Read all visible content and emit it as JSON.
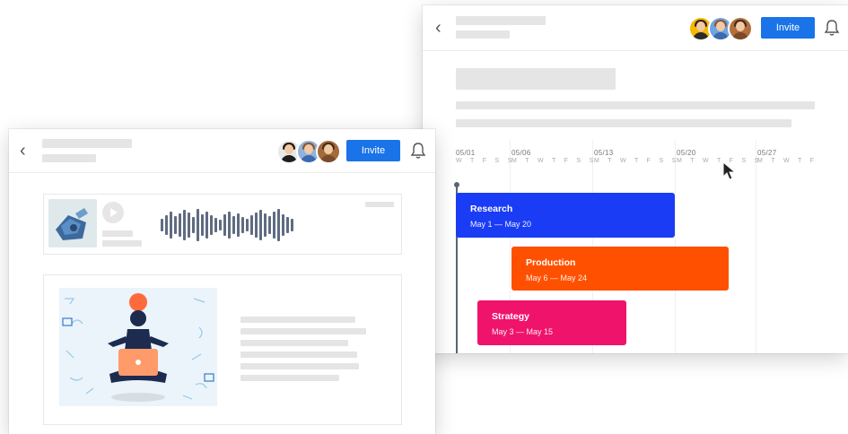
{
  "right_window": {
    "invite_label": "Invite",
    "timeline": {
      "weeks": [
        "05/01",
        "05/06",
        "05/13",
        "05/20",
        "05/27"
      ],
      "weekday_letters": [
        "W T F S S",
        "M T W T F S S",
        "M T W T F S S",
        "M T W T F S S",
        "M T W T F"
      ],
      "tasks": [
        {
          "name": "Research",
          "dates": "May 1 — May 20",
          "color": "#1a3cf5"
        },
        {
          "name": "Production",
          "dates": "May 6 — May 24",
          "color": "#ff5000"
        },
        {
          "name": "Strategy",
          "dates": "May 3 — May 15",
          "color": "#f0136b"
        }
      ]
    },
    "avatars": [
      "avatar-1",
      "avatar-2",
      "avatar-3"
    ],
    "icons": {
      "back": "chevron-left-icon",
      "bell": "bell-icon",
      "cursor": "mouse-pointer-icon"
    }
  },
  "left_window": {
    "invite_label": "Invite",
    "audio": {
      "thumbnail": "robot-icon",
      "play": "play-icon"
    },
    "illustration": "person-meditating-with-laptop",
    "icons": {
      "back": "chevron-left-icon",
      "bell": "bell-icon"
    }
  },
  "colors": {
    "accent": "#1a73e8",
    "research": "#1a3cf5",
    "production": "#ff5000",
    "strategy": "#f0136b",
    "skeleton": "#e5e5e5"
  }
}
